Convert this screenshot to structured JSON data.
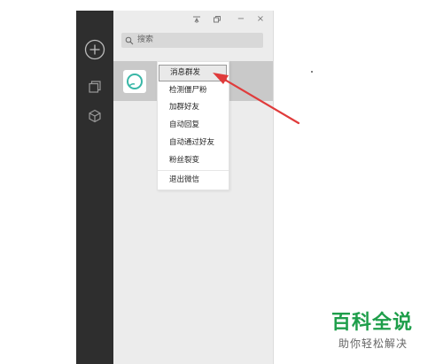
{
  "titlebar": {
    "pin_icon": "pin-icon",
    "restore_icon": "restore-icon",
    "minimize_label": "−",
    "close_label": "×"
  },
  "sidebar": {
    "items": [
      {
        "icon": "plus-circle-icon"
      },
      {
        "icon": "window-copy-icon"
      },
      {
        "icon": "cube-icon"
      }
    ]
  },
  "search": {
    "placeholder": "搜索"
  },
  "context_menu": {
    "items": [
      {
        "label": "消息群发",
        "active": true
      },
      {
        "label": "检测僵尸粉"
      },
      {
        "label": "加群好友"
      },
      {
        "label": "自动回复"
      },
      {
        "label": "自动通过好友"
      },
      {
        "label": "粉丝裂变"
      },
      {
        "label": "退出微信"
      }
    ]
  },
  "annotation": {
    "arrow_color": "#e03b3b"
  },
  "watermark": {
    "title": "百科全说",
    "subtitle": "助你轻松解决",
    "title_color": "#1e9e4a"
  }
}
